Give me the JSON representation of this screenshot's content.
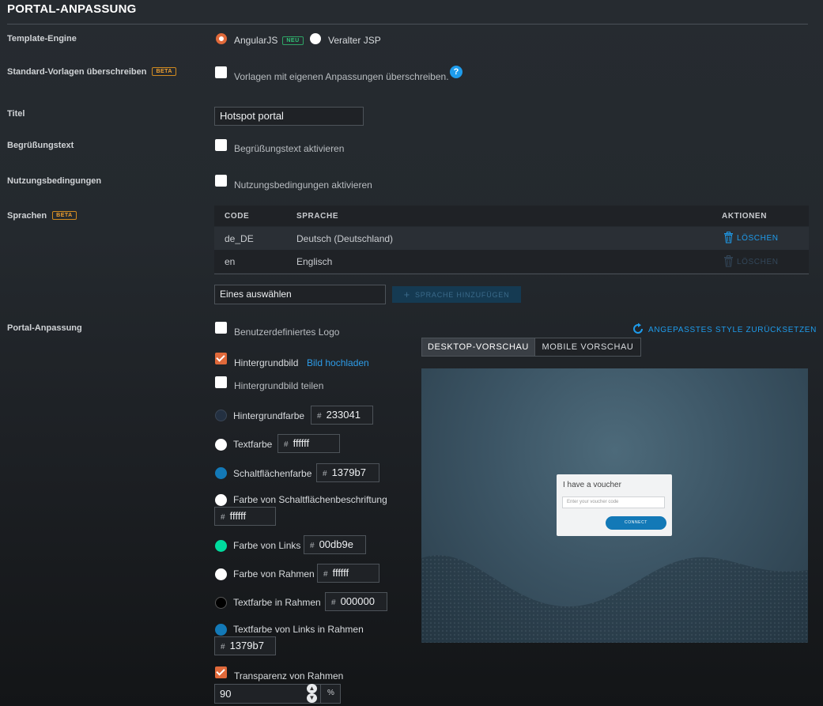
{
  "header": {
    "title": "PORTAL-ANPASSUNG"
  },
  "template_engine": {
    "label": "Template-Engine",
    "options": [
      {
        "label": "AngularJS",
        "badge": "NEU",
        "selected": true
      },
      {
        "label": "Veralter JSP",
        "selected": false
      }
    ]
  },
  "override_defaults": {
    "label": "Standard-Vorlagen überschreiben",
    "badge": "BETA",
    "checkbox_label": "Vorlagen mit eigenen Anpassungen überschreiben.",
    "checked": false,
    "help": "?"
  },
  "title_field": {
    "label": "Titel",
    "value": "Hotspot portal"
  },
  "welcome": {
    "label": "Begrüßungstext",
    "checkbox_label": "Begrüßungstext aktivieren",
    "checked": false
  },
  "terms": {
    "label": "Nutzungsbedingungen",
    "checkbox_label": "Nutzungsbedingungen aktivieren",
    "checked": false
  },
  "languages": {
    "label": "Sprachen",
    "badge": "BETA",
    "columns": [
      "CODE",
      "SPRACHE",
      "AKTIONEN"
    ],
    "rows": [
      {
        "code": "de_DE",
        "language": "Deutsch (Deutschland)",
        "action": "LÖSCHEN",
        "enabled": true
      },
      {
        "code": "en",
        "language": "Englisch",
        "action": "LÖSCHEN",
        "enabled": false
      }
    ],
    "select_value": "Eines auswählen",
    "add_button": "SPRACHE HINZUFÜGEN"
  },
  "portal": {
    "label": "Portal-Anpassung",
    "custom_logo": {
      "label": "Benutzerdefiniertes Logo",
      "checked": false
    },
    "background_image": {
      "label": "Hintergrundbild",
      "checked": true,
      "link": "Bild hochladen"
    },
    "tile_background": {
      "label": "Hintergrundbild teilen",
      "checked": false
    },
    "colors": [
      {
        "label": "Hintergrundfarbe",
        "value": "233041",
        "color": "#233041"
      },
      {
        "label": "Textfarbe",
        "value": "ffffff",
        "color": "#ffffff"
      },
      {
        "label": "Schaltflächenfarbe",
        "value": "1379b7",
        "color": "#1379b7"
      },
      {
        "label": "Farbe von Schaltflächenbeschriftung",
        "value": "ffffff",
        "color": "#ffffff"
      },
      {
        "label": "Farbe von Links",
        "value": "00db9e",
        "color": "#00db9e"
      },
      {
        "label": "Farbe von Rahmen",
        "value": "ffffff",
        "color": "#ffffff"
      },
      {
        "label": "Textfarbe in Rahmen",
        "value": "000000",
        "color": "#000000"
      },
      {
        "label": "Textfarbe von Links in Rahmen",
        "value": "1379b7",
        "color": "#1379b7"
      }
    ],
    "box_opacity": {
      "label": "Transparenz von Rahmen",
      "checked": true,
      "value": "90",
      "unit": "%"
    },
    "reset_link": "ANGEPASSTES STYLE ZURÜCKSETZEN",
    "tabs": [
      {
        "label": "DESKTOP-VORSCHAU",
        "active": true
      },
      {
        "label": "MOBILE VORSCHAU",
        "active": false
      }
    ],
    "preview": {
      "heading": "I have a voucher",
      "input_placeholder": "Enter your voucher code",
      "button": "CONNECT"
    }
  }
}
